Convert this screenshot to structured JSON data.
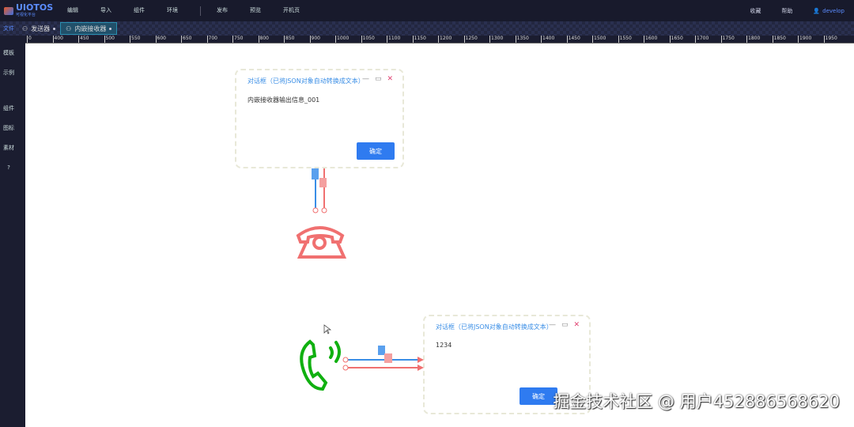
{
  "app": {
    "logo": "UIOTOS",
    "logo_sub": "可视化平台"
  },
  "menu": [
    "编辑",
    "导入",
    "组件",
    "环境",
    "发布",
    "预览",
    "开机页"
  ],
  "right_menu": {
    "fav": "收藏",
    "help": "帮助",
    "user": "develop"
  },
  "tabs": {
    "side_label": "文件",
    "items": [
      {
        "label": "发送器"
      },
      {
        "label": "内嵌接收器",
        "active": true
      }
    ]
  },
  "sidebar": [
    "模板",
    "示例",
    "组件",
    "图标",
    "素材",
    "?"
  ],
  "ruler": [
    "0",
    "400",
    "450",
    "500",
    "550",
    "600",
    "650",
    "700",
    "750",
    "800",
    "850",
    "900",
    "1000",
    "1050",
    "1100",
    "1150",
    "1200",
    "1250",
    "1300",
    "1350",
    "1400",
    "1450",
    "1500",
    "1550",
    "1600",
    "1650",
    "1700",
    "1750",
    "1800",
    "1850",
    "1900",
    "1950"
  ],
  "dialog1": {
    "title": "对话框（已将JSON对象自动转换成文本）",
    "content": "内嵌接收器输出信息_001",
    "ok": "确定"
  },
  "dialog2": {
    "title": "对话框（已将JSON对象自动转换成文本）",
    "content": "1234",
    "ok": "确定"
  },
  "watermark": "掘金技术社区 @ 用户452886568620",
  "colors": {
    "accent": "#2f7bf0",
    "red_phone": "#f07070",
    "green_phone": "#10b010"
  }
}
